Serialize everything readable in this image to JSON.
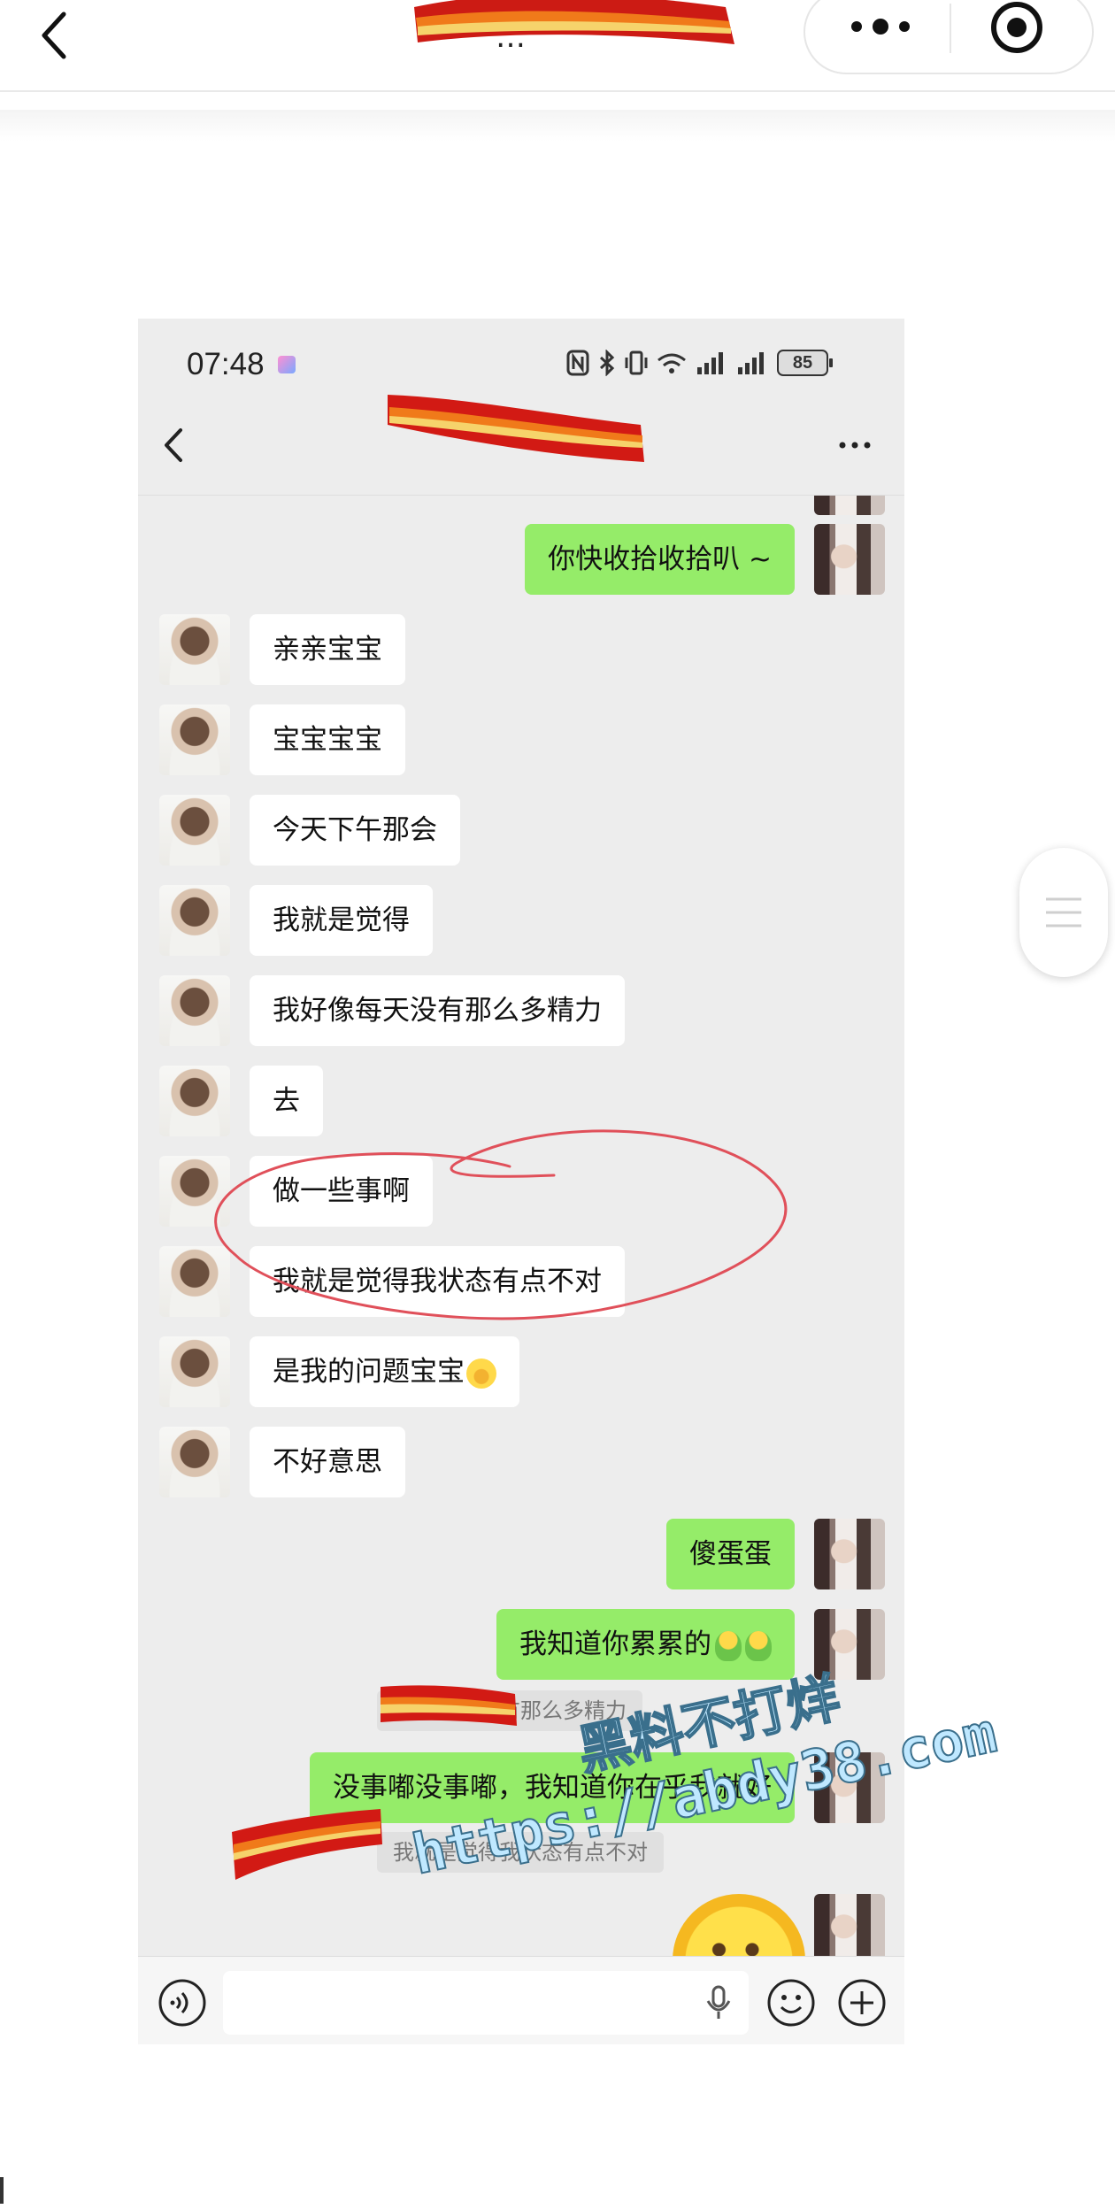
{
  "outer": {
    "title": "…"
  },
  "phone": {
    "status_time": "07:48",
    "battery": "85",
    "input_placeholder": ""
  },
  "messages": [
    {
      "side": "left",
      "text": "亲亲宝宝"
    },
    {
      "side": "left",
      "text": "宝宝宝宝"
    },
    {
      "side": "left",
      "text": "今天下午那会"
    },
    {
      "side": "left",
      "text": "我就是觉得"
    },
    {
      "side": "left",
      "text": "我好像每天没有那么多精力"
    },
    {
      "side": "left",
      "text": "去"
    },
    {
      "side": "left",
      "text": "做一些事啊"
    },
    {
      "side": "left",
      "text": "我就是觉得我状态有点不对"
    },
    {
      "side": "left",
      "text": "是我的问题宝宝"
    },
    {
      "side": "left",
      "text": "不好意思"
    },
    {
      "side": "right",
      "text": "傻蛋蛋"
    },
    {
      "side": "right",
      "text": "我知道你累累的"
    }
  ],
  "top_right_message": "你快收拾收拾叭 ~",
  "quote_1": "好像每天没有那么多精力",
  "reply_message": "没事嘟没事嘟，我知道你在乎我就好",
  "quote_2": "我就是觉得我状态有点不对",
  "watermark": {
    "line1": "黑料不打烊",
    "line2": "https://abdy38.com"
  },
  "colors": {
    "chat_bg": "#ededed",
    "my_bubble": "#95ec69",
    "their_bubble": "#ffffff",
    "annotation": "#e0505a"
  }
}
